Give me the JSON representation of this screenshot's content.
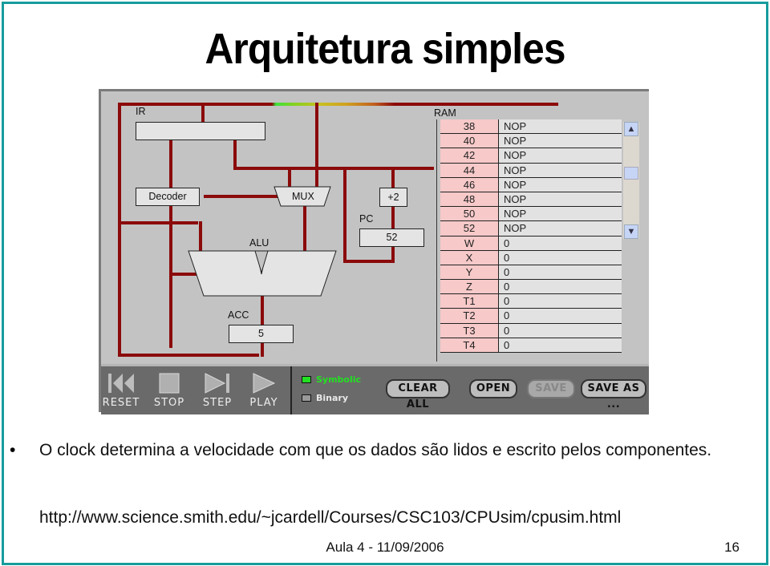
{
  "slide": {
    "title": "Arquitetura simples",
    "bullet": "O clock determina a velocidade com que os dados são lidos e escrito pelos componentes.",
    "url": "http://www.science.smith.edu/~jcardell/Courses/CSC103/CPUsim/cpusim.html",
    "footer": "Aula 4 - 11/09/2006",
    "page_number": "16",
    "border_color": "#169c9c"
  },
  "simulator": {
    "ir": {
      "label": "IR",
      "value": ""
    },
    "decoder": {
      "label": "Decoder"
    },
    "mux": {
      "label": "MUX"
    },
    "incrementer": {
      "label": "+2"
    },
    "pc": {
      "label": "PC",
      "value": "52"
    },
    "alu": {
      "label": "ALU"
    },
    "acc": {
      "label": "ACC",
      "value": "5"
    },
    "ram": {
      "label": "RAM",
      "rows": [
        {
          "addr": "38",
          "value": "NOP"
        },
        {
          "addr": "40",
          "value": "NOP"
        },
        {
          "addr": "42",
          "value": "NOP"
        },
        {
          "addr": "44",
          "value": "NOP"
        },
        {
          "addr": "46",
          "value": "NOP"
        },
        {
          "addr": "48",
          "value": "NOP"
        },
        {
          "addr": "50",
          "value": "NOP"
        },
        {
          "addr": "52",
          "value": "NOP"
        },
        {
          "addr": "W",
          "value": "0"
        },
        {
          "addr": "X",
          "value": "0"
        },
        {
          "addr": "Y",
          "value": "0"
        },
        {
          "addr": "Z",
          "value": "0"
        },
        {
          "addr": "T1",
          "value": "0"
        },
        {
          "addr": "T2",
          "value": "0"
        },
        {
          "addr": "T3",
          "value": "0"
        },
        {
          "addr": "T4",
          "value": "0"
        }
      ]
    },
    "controls": {
      "reset": "RESET",
      "stop": "STOP",
      "step": "STEP",
      "play": "PLAY"
    },
    "modes": {
      "symbolic": "Symbolic",
      "binary": "Binary",
      "selected": "Symbolic",
      "symbolic_color": "#22e022"
    },
    "buttons": {
      "clear_all": "CLEAR ALL",
      "open": "OPEN",
      "save": "SAVE",
      "save_as": "SAVE AS ..."
    },
    "colors": {
      "wire": "#8b0a0a",
      "ram_addr_bg": "#f7c9c9"
    }
  }
}
